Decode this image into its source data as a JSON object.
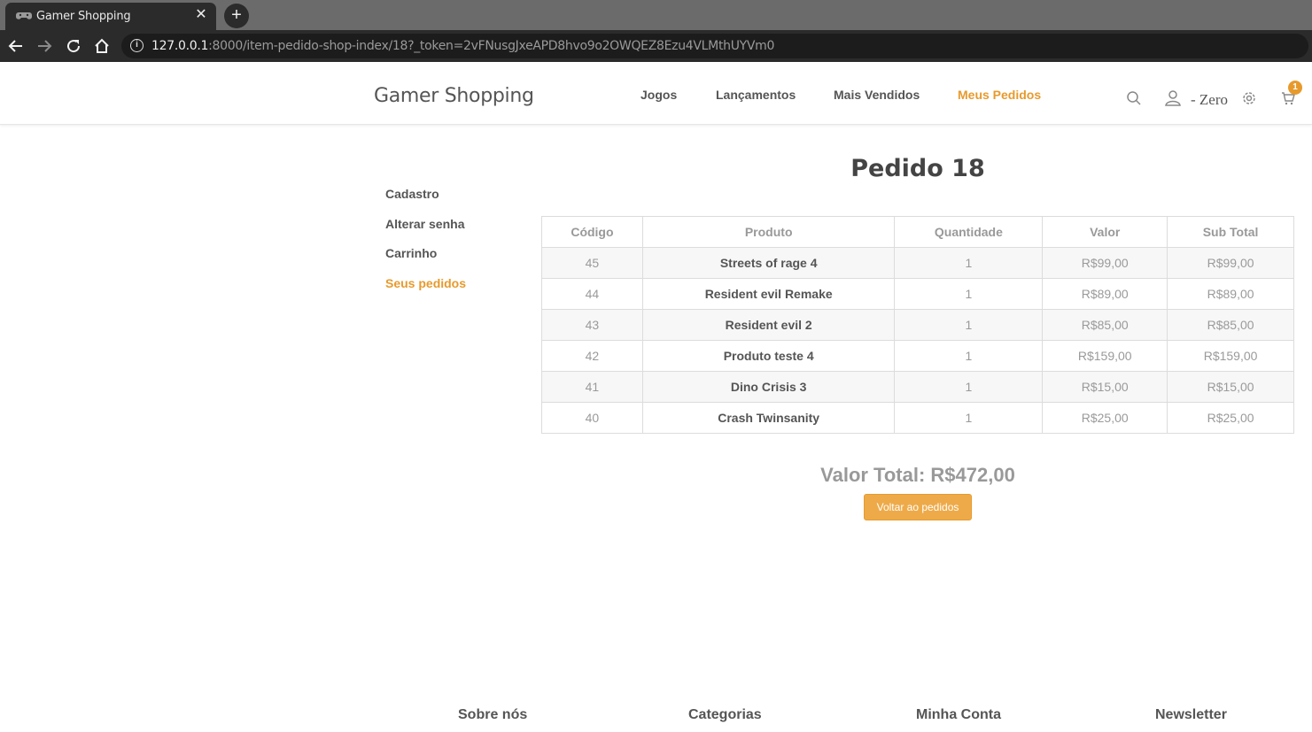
{
  "browser": {
    "tab_title": "Gamer Shopping",
    "tab_icon": "gamepad-icon",
    "url_host": "127.0.0.1",
    "url_rest": ":8000/item-pedido-shop-index/18?_token=2vFNusgJxeAPD8hvo9o2OWQEZ8Ezu4VLMthUYVm0"
  },
  "header": {
    "brand": "Gamer Shopping",
    "menu": [
      {
        "label": "Jogos",
        "active": false
      },
      {
        "label": "Lançamentos",
        "active": false
      },
      {
        "label": "Mais Vendidos",
        "active": false
      },
      {
        "label": "Meus Pedidos",
        "active": true
      }
    ],
    "user_label": "- Zero",
    "cart_count": "1",
    "accent_color": "#e79a2c"
  },
  "sidebar": {
    "items": [
      {
        "label": "Cadastro",
        "active": false
      },
      {
        "label": "Alterar senha",
        "active": false
      },
      {
        "label": "Carrinho",
        "active": false
      },
      {
        "label": "Seus pedidos",
        "active": true
      }
    ]
  },
  "main": {
    "title": "Pedido 18",
    "columns": [
      "Código",
      "Produto",
      "Quantidade",
      "Valor",
      "Sub Total"
    ],
    "rows": [
      {
        "codigo": "45",
        "produto": "Streets of rage 4",
        "quantidade": "1",
        "valor": "R$99,00",
        "subtotal": "R$99,00"
      },
      {
        "codigo": "44",
        "produto": "Resident evil Remake",
        "quantidade": "1",
        "valor": "R$89,00",
        "subtotal": "R$89,00"
      },
      {
        "codigo": "43",
        "produto": "Resident evil 2",
        "quantidade": "1",
        "valor": "R$85,00",
        "subtotal": "R$85,00"
      },
      {
        "codigo": "42",
        "produto": "Produto teste 4",
        "quantidade": "1",
        "valor": "R$159,00",
        "subtotal": "R$159,00"
      },
      {
        "codigo": "41",
        "produto": "Dino Crisis 3",
        "quantidade": "1",
        "valor": "R$15,00",
        "subtotal": "R$15,00"
      },
      {
        "codigo": "40",
        "produto": "Crash Twinsanity",
        "quantidade": "1",
        "valor": "R$25,00",
        "subtotal": "R$25,00"
      }
    ],
    "total": "Valor Total: R$472,00",
    "back_button": "Voltar ao pedidos"
  },
  "footer": {
    "headings": [
      "Sobre nós",
      "Categorias",
      "Minha Conta",
      "Newsletter"
    ]
  }
}
